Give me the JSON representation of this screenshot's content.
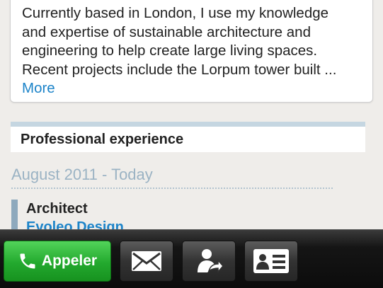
{
  "summary": {
    "lines": [
      "Currently based in London, I use my knowledge",
      "and expertise of sustainable architecture and",
      "engineering to help create large living spaces.",
      "Recent projects include the Lorpum tower built ..."
    ],
    "more_label": "More"
  },
  "experience": {
    "section_title": "Professional experience",
    "date_range": "August 2011 - Today",
    "job_title": "Architect",
    "company": "Evoleo Design"
  },
  "toolbar": {
    "call_label": "Appeler",
    "call_icon": "phone-icon",
    "mail_icon": "envelope-icon",
    "share_icon": "share-contact-icon",
    "card_icon": "contact-card-icon"
  },
  "colors": {
    "link": "#1d84c9",
    "accent_bar": "#c5d6e1",
    "date_text": "#9bb3c4",
    "call_green": "#23a92e"
  }
}
